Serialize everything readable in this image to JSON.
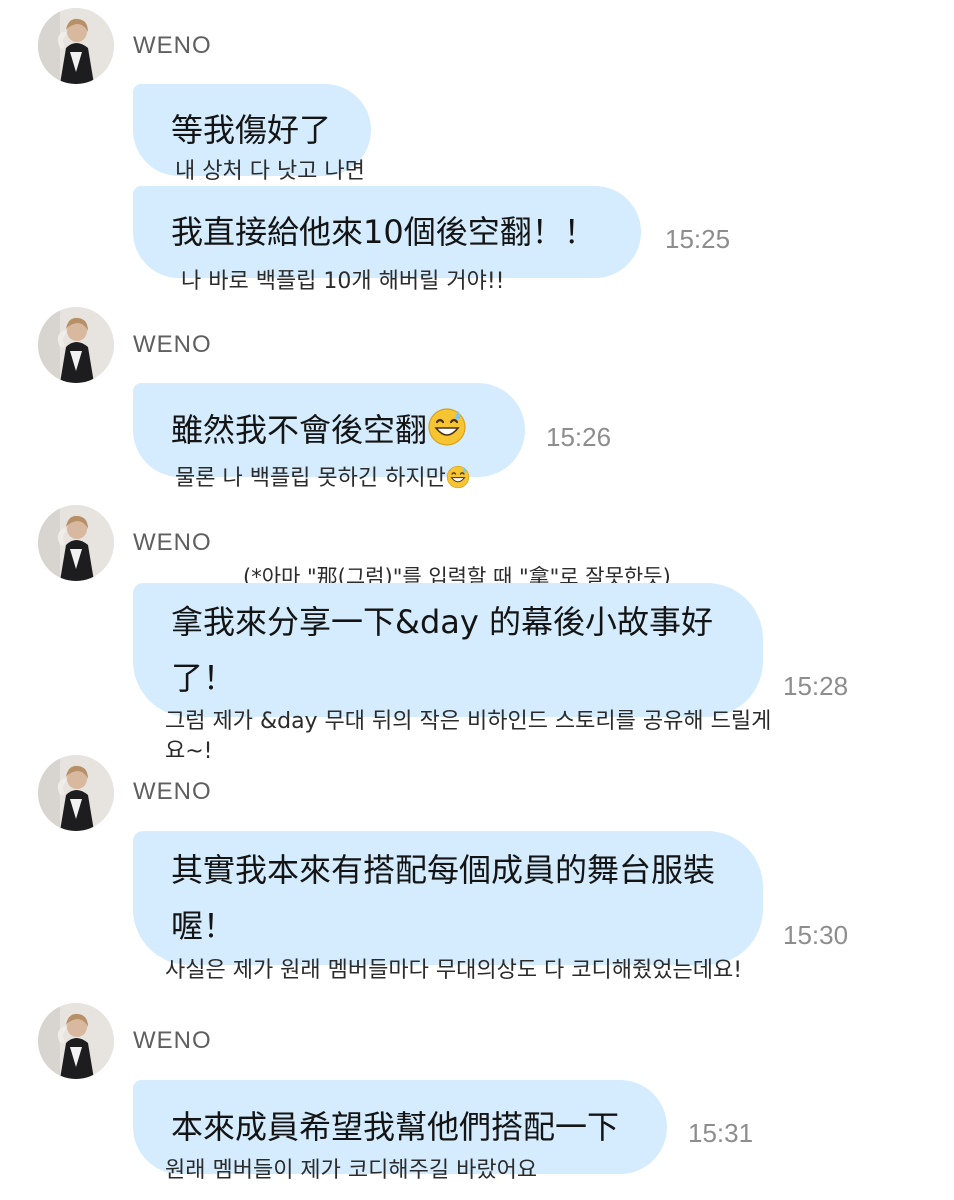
{
  "sender_name": "WENO",
  "messages": [
    {
      "zh_lines": [
        "等我傷好了",
        "我直接給他來10個後空翻！！"
      ],
      "ko_lines": [
        "내 상처 다 낫고 나면",
        "나 바로 백플립 10개 해버릴 거야!!"
      ],
      "time": "15:25"
    },
    {
      "zh": "雖然我不會後空翻",
      "ko": "물론 나 백플립 못하긴 하지만",
      "time": "15:26",
      "emoji": "sweat-smile-emoji"
    },
    {
      "note": "(*아마 \"那(그럼)\"를 입력할 때 \"拿\"로 잘못한듯)",
      "zh": "拿我來分享一下&day 的幕後小故事好了！",
      "ko": "그럼 제가 &day 무대 뒤의 작은 비하인드 스토리를 공유해 드릴게요~!",
      "time": "15:28"
    },
    {
      "zh": "其實我本來有搭配每個成員的舞台服裝喔！",
      "ko": "사실은 제가 원래 멤버들마다 무대의상도 다 코디해줬었는데요!",
      "time": "15:30"
    },
    {
      "zh": "本來成員希望我幫他們搭配一下",
      "ko": "원래 멤버들이 제가 코디해주길 바랐어요",
      "time": "15:31"
    }
  ],
  "colors": {
    "bubble": "#d4ecfd",
    "time": "#8d8d8d",
    "sender": "#5f5f5f",
    "background": "#ffffff"
  }
}
